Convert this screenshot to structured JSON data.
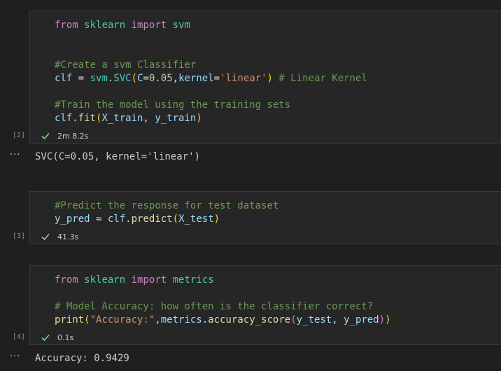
{
  "cells": [
    {
      "exec_count": "[2]",
      "duration": "2m 8.2s",
      "output": "SVC(C=0.05, kernel='linear')",
      "lines": [
        {
          "kw1": "from",
          "mod": "sklearn",
          "kw2": "import",
          "mod2": "svm"
        },
        {
          "text": ""
        },
        {
          "text": ""
        },
        {
          "comment": "#Create a svm Classifier"
        },
        {
          "v1": "clf",
          "op": " = ",
          "v2": "svm",
          "dot": ".",
          "fn": "SVC",
          "p1": "(",
          "arg1": "C",
          "eq1": "=",
          "num": "0.05",
          "comma": ",",
          "arg2": "kernel",
          "eq2": "=",
          "str": "'linear'",
          "p2": ")",
          "comment": " # Linear Kernel"
        },
        {
          "text": ""
        },
        {
          "comment": "#Train the model using the training sets"
        },
        {
          "v1": "clf",
          "dot": ".",
          "fn": "fit",
          "p1": "(",
          "a1": "X_train",
          "sep": ", ",
          "a2": "y_train",
          "p2": ")"
        }
      ]
    },
    {
      "exec_count": "[3]",
      "duration": "41.3s",
      "lines": [
        {
          "comment": "#Predict the response for test dataset"
        },
        {
          "v1": "y_pred",
          "op": " = ",
          "v2": "clf",
          "dot": ".",
          "fn": "predict",
          "p1": "(",
          "a1": "X_test",
          "p2": ")"
        }
      ]
    },
    {
      "exec_count": "[4]",
      "duration": "0.1s",
      "output": "Accuracy: 0.9429",
      "lines": [
        {
          "kw1": "from",
          "mod": "sklearn",
          "kw2": "import",
          "mod2": "metrics"
        },
        {
          "text": ""
        },
        {
          "comment": "# Model Accuracy: how often is the classifier correct?"
        },
        {
          "fn": "print",
          "p1": "(",
          "str": "\"Accuracy:\"",
          "comma": ",",
          "v1": "metrics",
          "dot": ".",
          "fn2": "accuracy_score",
          "p2": "(",
          "a1": "y_test",
          "sep": ", ",
          "a2": "y_pred",
          "p3": ")",
          "p4": ")"
        }
      ]
    }
  ],
  "output_more_glyph": "···",
  "colors": {
    "check": "#89d185",
    "background": "#1f1f1f",
    "cell": "#262626"
  }
}
